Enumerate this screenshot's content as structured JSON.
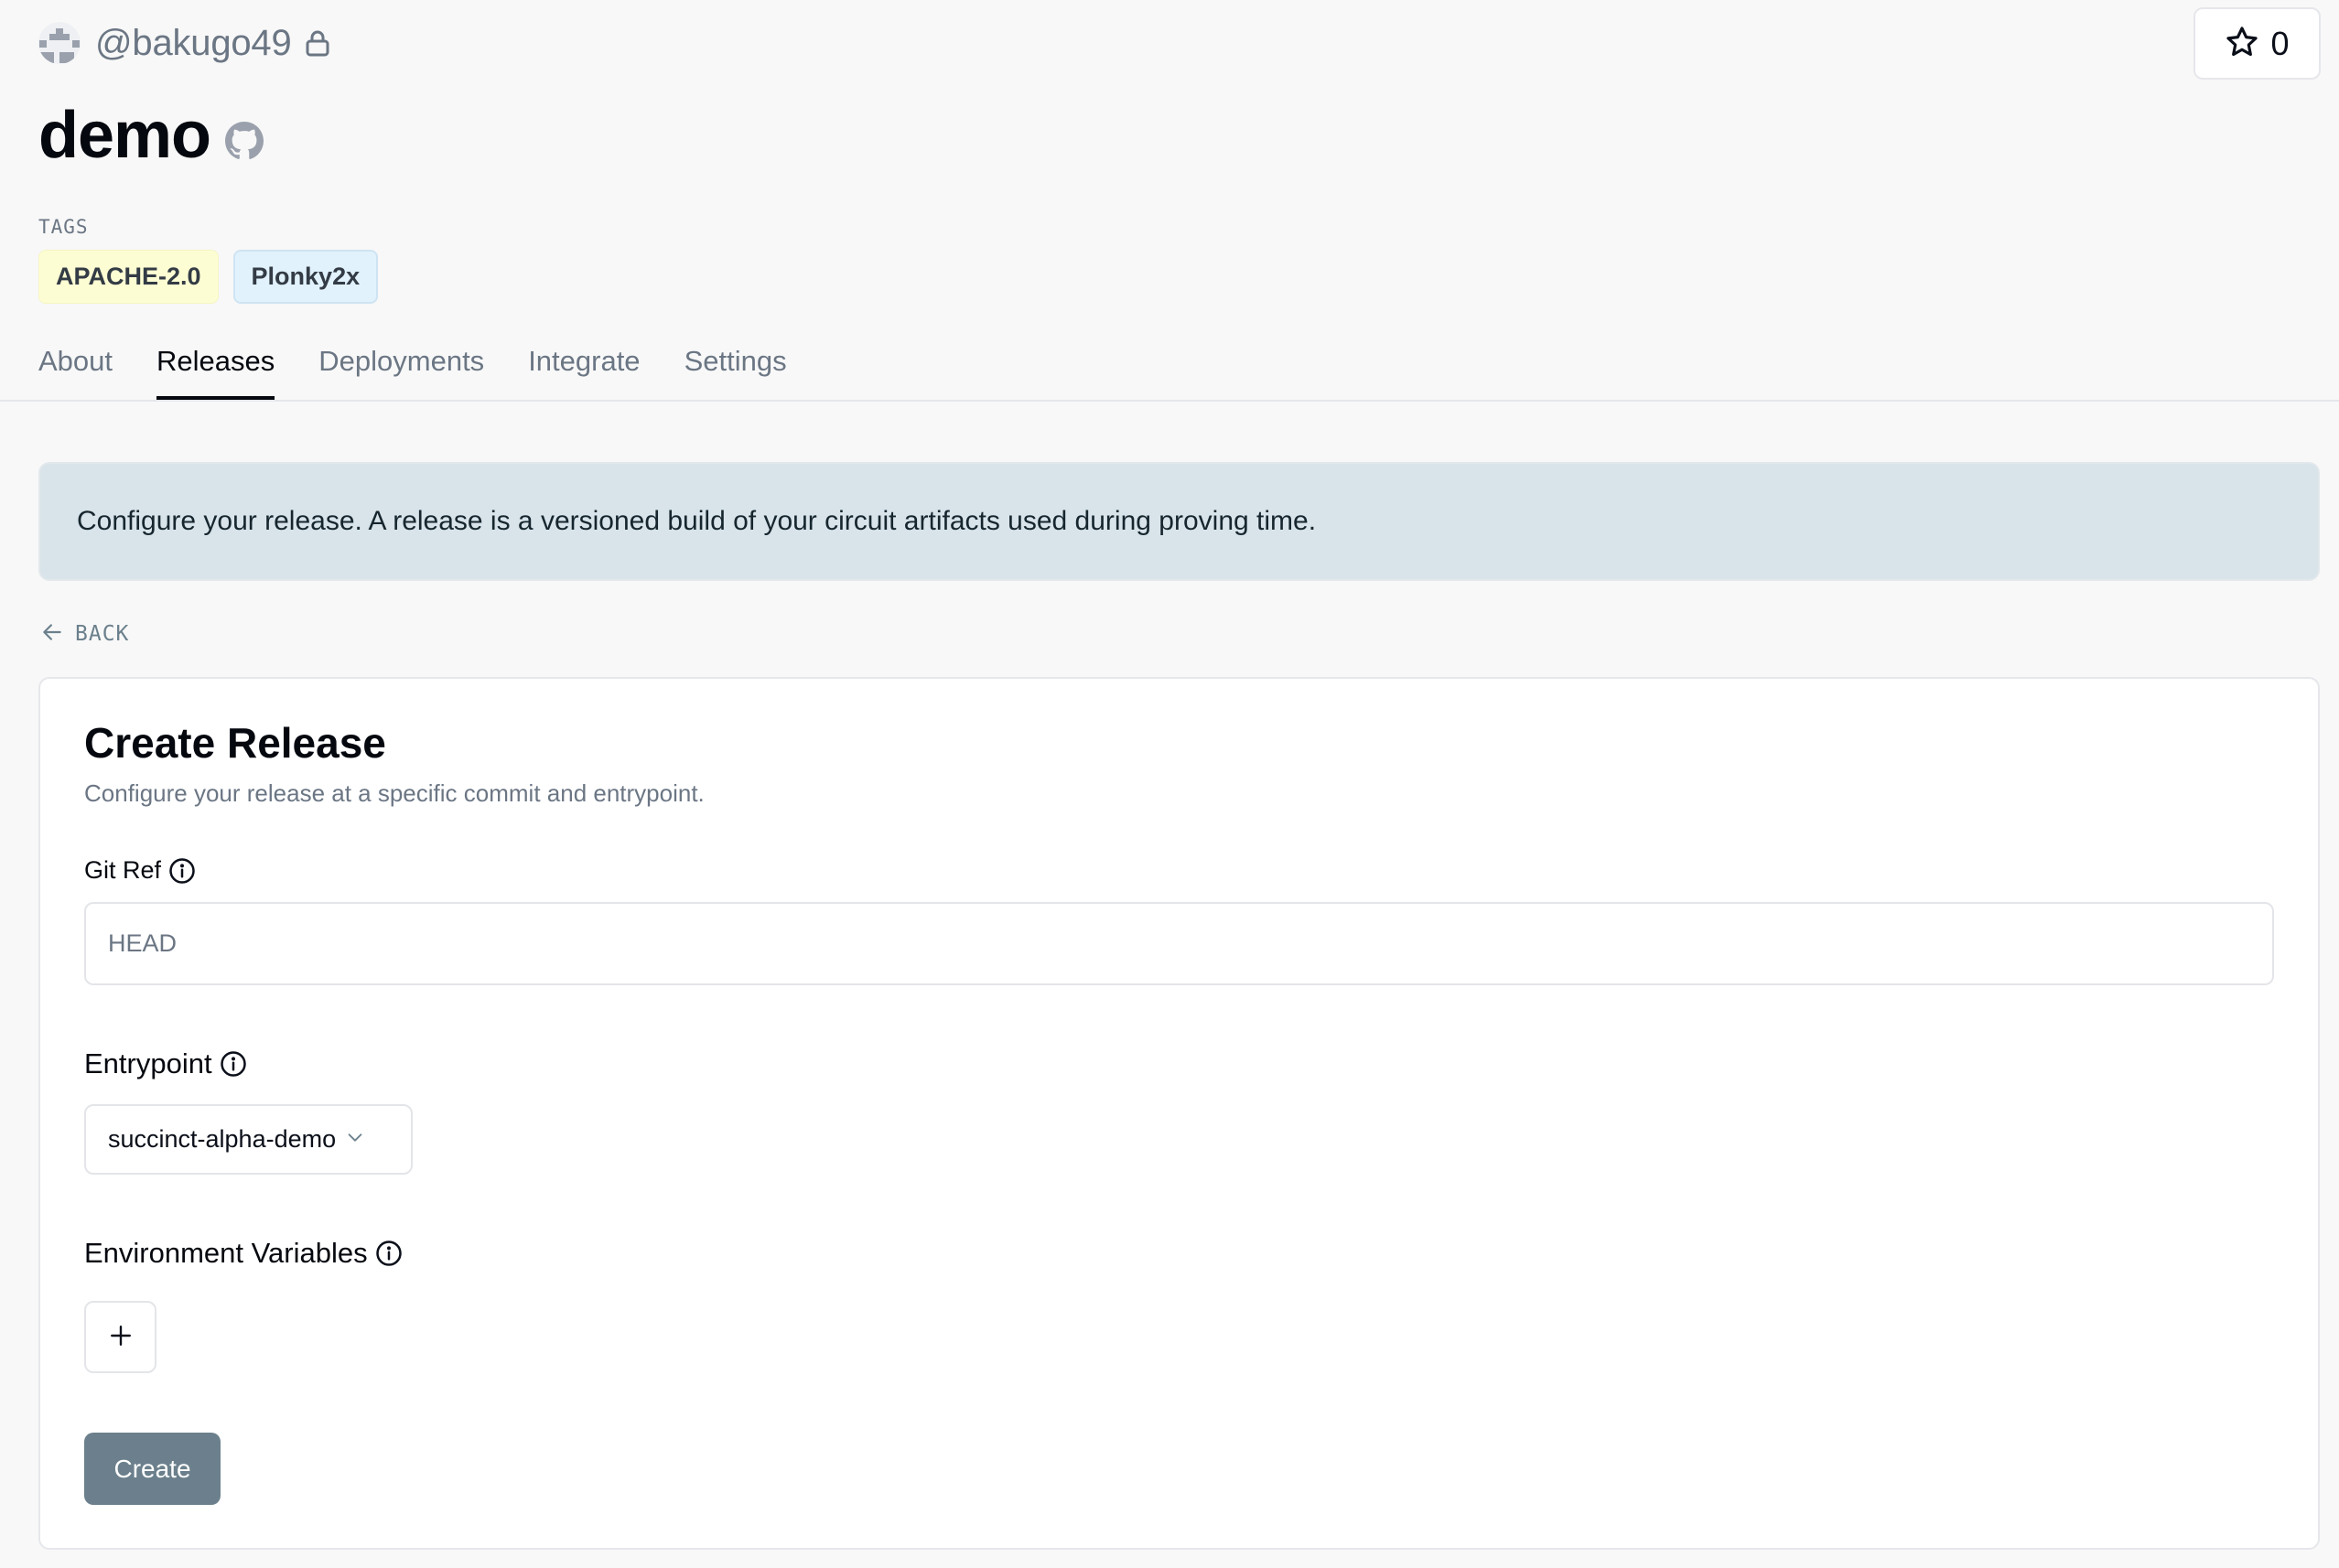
{
  "header": {
    "owner": "@bakugo49",
    "owner_avatar_icon": "identicon-avatar",
    "visibility_icon": "lock-icon",
    "star_count": "0",
    "star_icon": "star-icon",
    "repo_name": "demo",
    "repo_source_icon": "github-icon"
  },
  "tags": {
    "label": "TAGS",
    "items": [
      {
        "label": "APACHE-2.0",
        "color": "#fdfdd3"
      },
      {
        "label": "Plonky2x",
        "color": "#e1f2fd"
      }
    ]
  },
  "tabs": [
    {
      "label": "About",
      "active": false
    },
    {
      "label": "Releases",
      "active": true
    },
    {
      "label": "Deployments",
      "active": false
    },
    {
      "label": "Integrate",
      "active": false
    },
    {
      "label": "Settings",
      "active": false
    }
  ],
  "banner": {
    "text": "Configure your release. A release is a versioned build of your circuit artifacts used during proving time."
  },
  "back": {
    "label": "BACK",
    "icon": "arrow-left-icon"
  },
  "form": {
    "title": "Create Release",
    "subtitle": "Configure your release at a specific commit and entrypoint.",
    "git_ref": {
      "label": "Git Ref",
      "value": "",
      "placeholder": "HEAD"
    },
    "entrypoint": {
      "label": "Entrypoint",
      "selected": "succinct-alpha-demo"
    },
    "env_vars": {
      "label": "Environment Variables",
      "add_label": "+"
    },
    "submit_label": "Create"
  },
  "colors": {
    "accent": "#6b808c",
    "banner_bg": "#d8e4ea",
    "page_bg": "#f8f8f8",
    "text_muted": "#6b7684"
  }
}
